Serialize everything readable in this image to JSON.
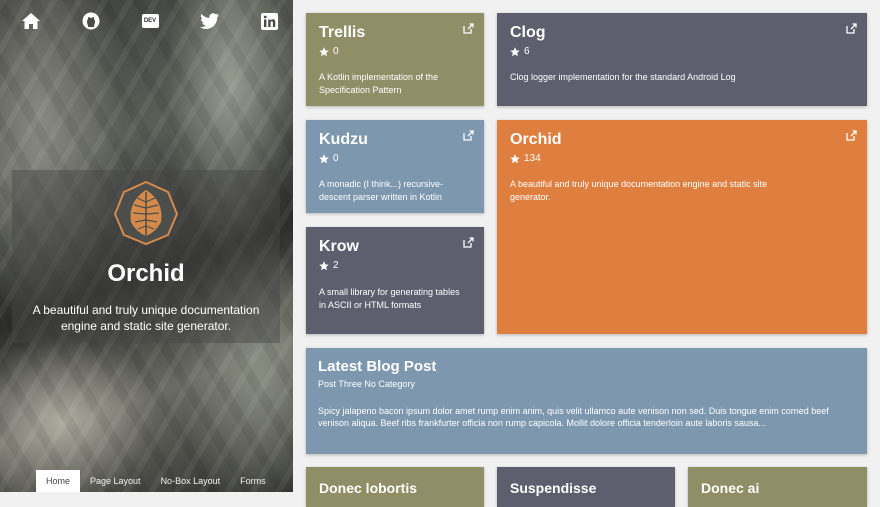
{
  "hero": {
    "title": "Orchid",
    "subtitle": "A beautiful and truly unique documentation engine and static site generator.",
    "social_icons": [
      "home-icon",
      "github-icon",
      "dev-icon",
      "twitter-icon",
      "linkedin-icon"
    ],
    "dev_label": "DEV",
    "nav": [
      "Home",
      "Page Layout",
      "No-Box Layout",
      "Forms"
    ]
  },
  "cards": {
    "trellis": {
      "title": "Trellis",
      "stars": "0",
      "desc": "A Kotlin implementation of the Specification Pattern"
    },
    "clog": {
      "title": "Clog",
      "stars": "6",
      "desc": "Clog logger implementation for the standard Android Log"
    },
    "kudzu": {
      "title": "Kudzu",
      "stars": "0",
      "desc": "A monadic (I think...) recursive-descent parser written in Kotlin"
    },
    "orchid": {
      "title": "Orchid",
      "stars": "134",
      "desc": "A beautiful and truly unique documentation engine and static site generator."
    },
    "krow": {
      "title": "Krow",
      "stars": "2",
      "desc": "A small library for generating tables in ASCII or HTML formats"
    }
  },
  "blog": {
    "title": "Latest Blog Post",
    "subtitle": "Post Three No Category",
    "body": "Spicy jalapeno bacon ipsum dolor amet rump enim anim, quis velit ullamco aute venison non sed. Duis tongue enim corned beef venison aliqua. Beef ribs frankfurter officia non rump capicola. Mollit dolore officia tenderloin aute laboris sausa..."
  },
  "bottom_cards": [
    "Donec lobortis",
    "Suspendisse",
    "Donec ai"
  ],
  "colors": {
    "olive": "#908e66",
    "slate": "#5f5e6f",
    "steel": "#7d97ae",
    "orange": "#de7f3f"
  }
}
